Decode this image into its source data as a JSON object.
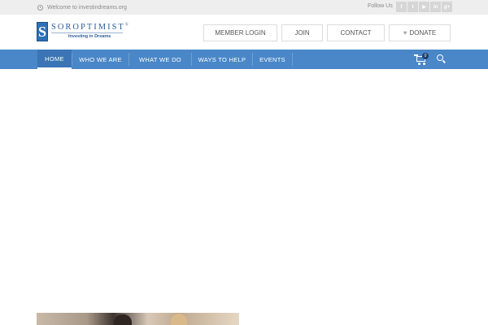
{
  "topbar": {
    "welcome": "Welcome to investindreams.org",
    "follow_us": "Follow Us",
    "socials": [
      {
        "icon": "facebook-icon",
        "glyph": "f"
      },
      {
        "icon": "twitter-icon",
        "glyph": "t"
      },
      {
        "icon": "youtube-icon",
        "glyph": "▶"
      },
      {
        "icon": "linkedin-icon",
        "glyph": "in"
      },
      {
        "icon": "googleplus-icon",
        "glyph": "g+"
      }
    ]
  },
  "logo": {
    "mark": "S",
    "name": "SOROPTIMIST",
    "registered": "®",
    "tagline": "Investing in Dreams"
  },
  "header_buttons": {
    "member_login": "MEMBER LOGIN",
    "join": "JOIN",
    "contact": "CONTACT",
    "donate": "DONATE"
  },
  "nav": {
    "items": [
      "HOME",
      "WHO WE ARE",
      "WHAT WE DO",
      "WAYS TO HELP",
      "EVENTS"
    ],
    "active": "HOME",
    "cart_count": "0"
  },
  "colors": {
    "nav": "#4a87c8",
    "nav_active": "#3b75b6",
    "topbar": "#eeeeee",
    "brand": "#2e5d9a"
  }
}
